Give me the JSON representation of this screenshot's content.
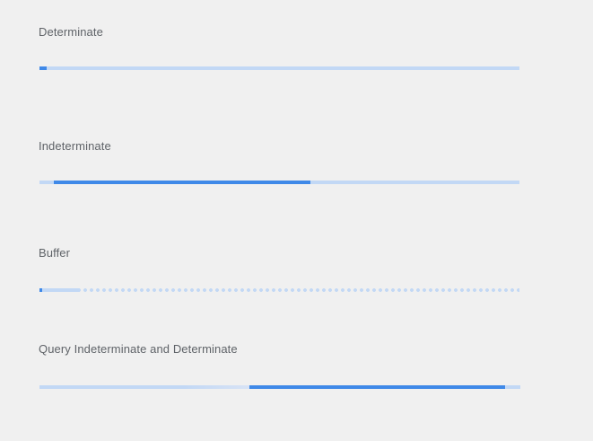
{
  "sections": [
    {
      "label": "Determinate",
      "type": "determinate",
      "progress_percent": 1.5
    },
    {
      "label": "Indeterminate",
      "type": "indeterminate",
      "bar_start_percent": 3,
      "bar_end_percent": 56.5
    },
    {
      "label": "Buffer",
      "type": "buffer",
      "progress_percent": 0.6,
      "buffer_percent": 8.5
    },
    {
      "label": "Query Indeterminate and Determinate",
      "type": "query",
      "bar_start_percent": 43.7,
      "bar_end_percent": 96.8
    }
  ],
  "colors": {
    "background": "#f0f0f0",
    "track": "#c2d8f5",
    "fill": "#3f89e8",
    "label": "#5f6368"
  }
}
